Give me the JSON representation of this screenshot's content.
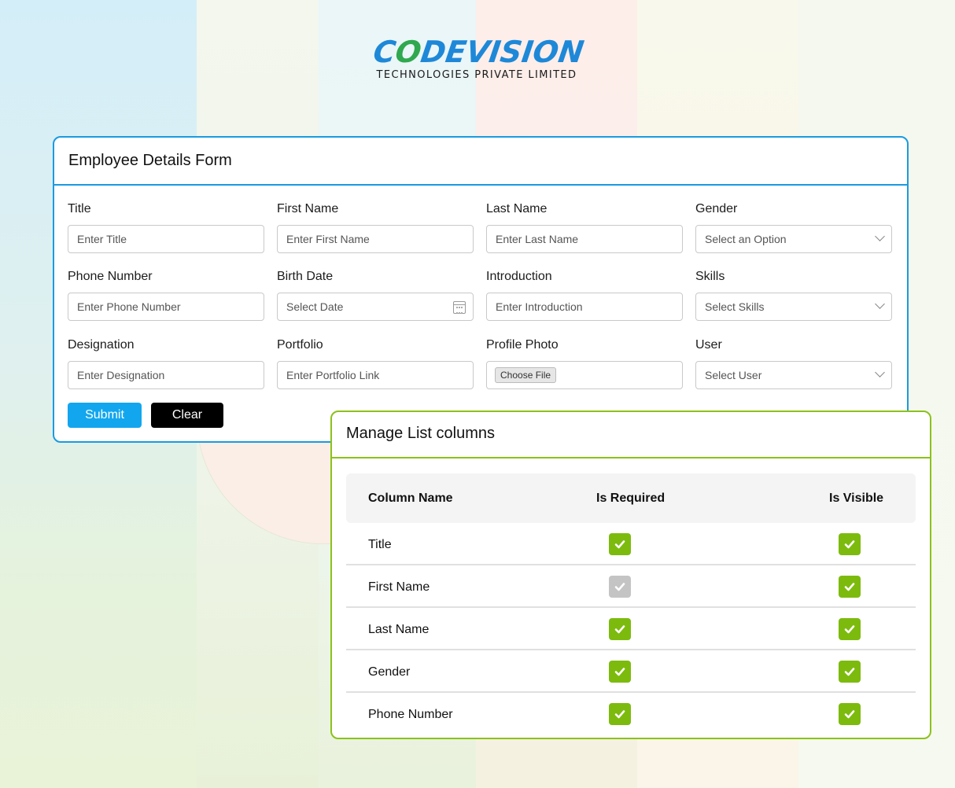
{
  "brand": {
    "name_part1": "C",
    "name_part2": "O",
    "name_part3": "DEVISION",
    "subtitle": "TECHNOLOGIES PRIVATE LIMITED",
    "colors": {
      "primary": "#1e88d8",
      "green": "#2fa84f",
      "orange": "#f0a000"
    }
  },
  "employee_form": {
    "title": "Employee Details Form",
    "fields": [
      {
        "label": "Title",
        "placeholder": "Enter Title",
        "kind": "text"
      },
      {
        "label": "First Name",
        "placeholder": "Enter First Name",
        "kind": "text"
      },
      {
        "label": "Last Name",
        "placeholder": "Enter Last Name",
        "kind": "text"
      },
      {
        "label": "Gender",
        "placeholder": "Select an Option",
        "kind": "select"
      },
      {
        "label": "Phone Number",
        "placeholder": "Enter Phone Number",
        "kind": "text"
      },
      {
        "label": "Birth Date",
        "placeholder": "Select Date",
        "kind": "date"
      },
      {
        "label": "Introduction",
        "placeholder": "Enter Introduction",
        "kind": "text"
      },
      {
        "label": "Skills",
        "placeholder": "Select Skills",
        "kind": "select"
      },
      {
        "label": "Designation",
        "placeholder": "Enter Designation",
        "kind": "text"
      },
      {
        "label": "Portfolio",
        "placeholder": "Enter Portfolio Link",
        "kind": "text"
      },
      {
        "label": "Profile Photo",
        "placeholder": "Choose File",
        "kind": "file"
      },
      {
        "label": "User",
        "placeholder": "Select User",
        "kind": "select"
      }
    ],
    "submit_label": "Submit",
    "clear_label": "Clear",
    "accent": "#1a9be0"
  },
  "list_columns": {
    "title": "Manage List columns",
    "headers": {
      "name": "Column Name",
      "required": "Is Required",
      "visible": "Is Visible"
    },
    "rows": [
      {
        "name": "Title",
        "required": true,
        "required_disabled": false,
        "visible": true
      },
      {
        "name": "First Name",
        "required": true,
        "required_disabled": true,
        "visible": true
      },
      {
        "name": "Last Name",
        "required": true,
        "required_disabled": false,
        "visible": true
      },
      {
        "name": "Gender",
        "required": true,
        "required_disabled": false,
        "visible": true
      },
      {
        "name": "Phone Number",
        "required": true,
        "required_disabled": false,
        "visible": true
      }
    ],
    "accent": "#8bc21a",
    "check_color": "#7cbb0e",
    "check_disabled_color": "#c4c4c4"
  }
}
